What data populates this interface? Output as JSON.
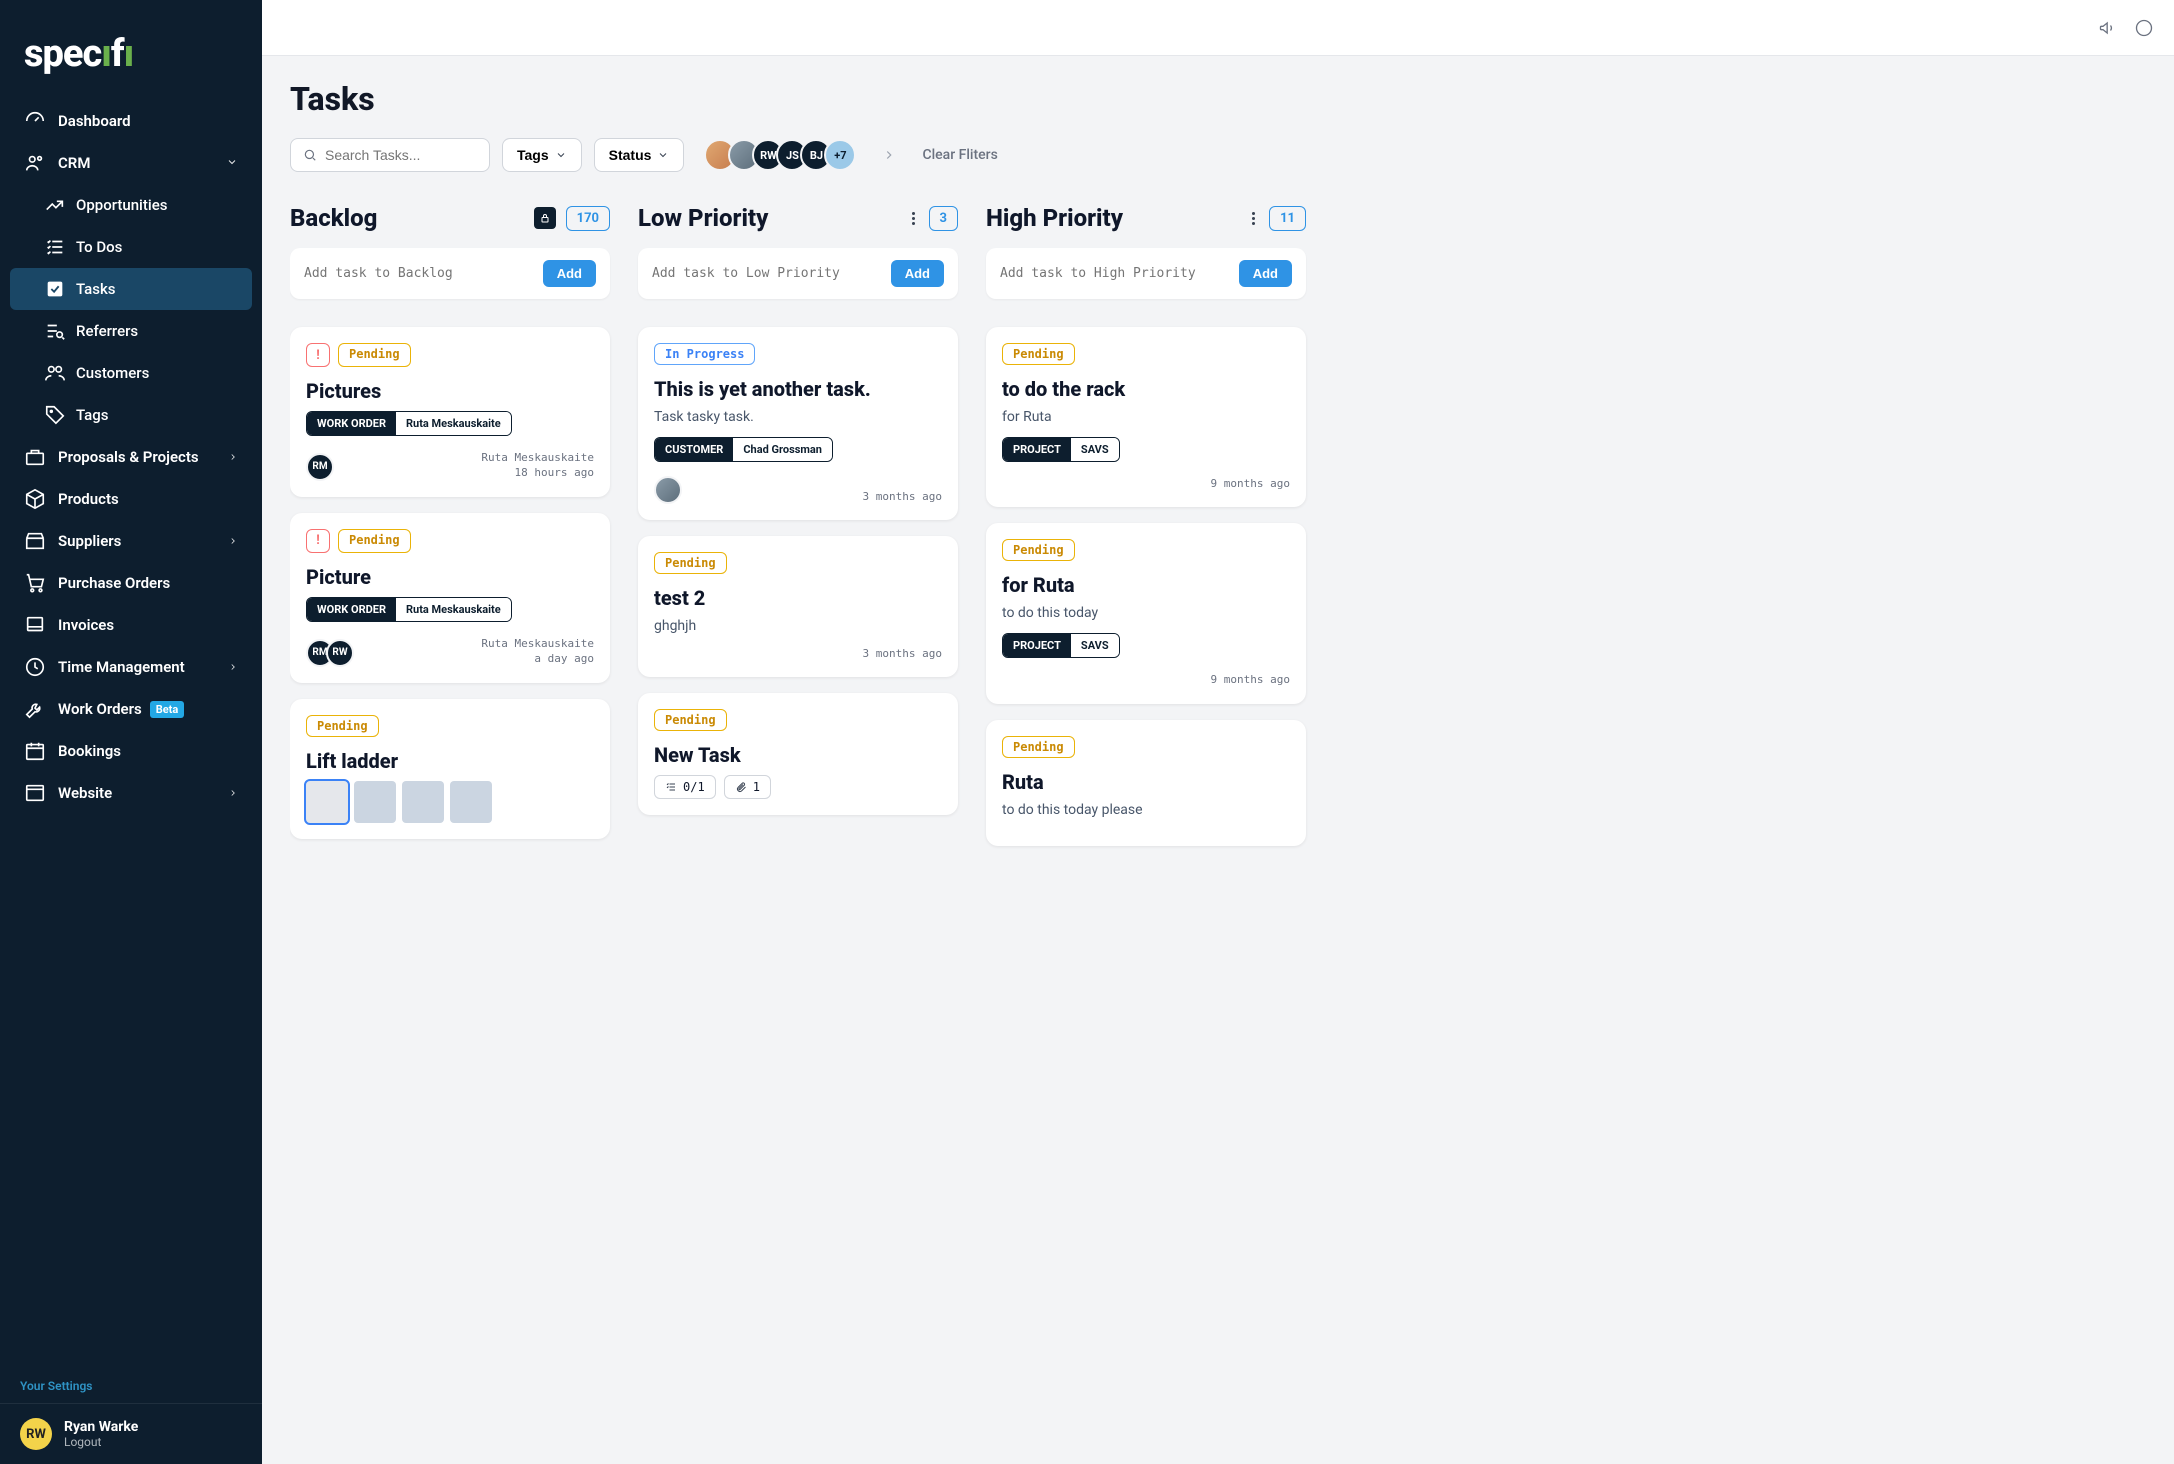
{
  "brand": "specifi",
  "nav": {
    "dashboard": "Dashboard",
    "crm": "CRM",
    "opportunities": "Opportunities",
    "todos": "To Dos",
    "tasks": "Tasks",
    "referrers": "Referrers",
    "customers": "Customers",
    "tags": "Tags",
    "proposals": "Proposals & Projects",
    "products": "Products",
    "suppliers": "Suppliers",
    "purchase_orders": "Purchase Orders",
    "invoices": "Invoices",
    "time_mgmt": "Time Management",
    "work_orders": "Work Orders",
    "work_orders_badge": "Beta",
    "bookings": "Bookings",
    "website": "Website"
  },
  "settings_link": "Your Settings",
  "user": {
    "initials": "RW",
    "name": "Ryan Warke",
    "logout": "Logout"
  },
  "page": {
    "title": "Tasks",
    "search_placeholder": "Search Tasks...",
    "filter_tags": "Tags",
    "filter_status": "Status",
    "avatar_overflow": "+7",
    "clear_filters": "Clear Fliters",
    "stack": [
      "RW",
      "JS",
      "BJ"
    ]
  },
  "columns": [
    {
      "id": "backlog",
      "title": "Backlog",
      "count": "170",
      "locked": true,
      "add_placeholder": "Add task to Backlog",
      "add_label": "Add",
      "cards": [
        {
          "priority": true,
          "status": "Pending",
          "status_class": "pending",
          "title": "Pictures",
          "tag_k": "WORK ORDER",
          "tag_v": "Ruta Meskauskaite",
          "assignees": [
            "RM"
          ],
          "meta1": "Ruta Meskauskaite",
          "meta2": "18 hours ago"
        },
        {
          "priority": true,
          "status": "Pending",
          "status_class": "pending",
          "title": "Picture",
          "tag_k": "WORK ORDER",
          "tag_v": "Ruta Meskauskaite",
          "assignees": [
            "RM",
            "RW"
          ],
          "meta1": "Ruta Meskauskaite",
          "meta2": "a day ago"
        },
        {
          "status": "Pending",
          "status_class": "pending",
          "title": "Lift ladder",
          "thumbs": 4
        }
      ]
    },
    {
      "id": "low",
      "title": "Low Priority",
      "count": "3",
      "add_placeholder": "Add task to Low Priority",
      "add_label": "Add",
      "cards": [
        {
          "status": "In Progress",
          "status_class": "progress",
          "title": "This is yet another task.",
          "desc": "Task tasky task.",
          "tag_k": "CUSTOMER",
          "tag_v": "Chad Grossman",
          "assignees_img": true,
          "meta2": "3 months ago"
        },
        {
          "status": "Pending",
          "status_class": "pending",
          "title": "test 2",
          "desc": "ghghjh",
          "meta2": "3 months ago"
        },
        {
          "status": "Pending",
          "status_class": "pending",
          "title": "New Task",
          "chips": {
            "checklist": "0/1",
            "attach": "1"
          }
        }
      ]
    },
    {
      "id": "high",
      "title": "High Priority",
      "count": "11",
      "add_placeholder": "Add task to High Priority",
      "add_label": "Add",
      "cards": [
        {
          "status": "Pending",
          "status_class": "pending",
          "title": "to do the rack",
          "desc": "for Ruta",
          "tag_k": "PROJECT",
          "tag_v": "SAVS",
          "meta2": "9 months ago"
        },
        {
          "status": "Pending",
          "status_class": "pending",
          "title": "for Ruta",
          "desc": "to do this today",
          "tag_k": "PROJECT",
          "tag_v": "SAVS",
          "meta2": "9 months ago"
        },
        {
          "status": "Pending",
          "status_class": "pending",
          "title": "Ruta",
          "desc": "to do this today please"
        }
      ]
    }
  ]
}
